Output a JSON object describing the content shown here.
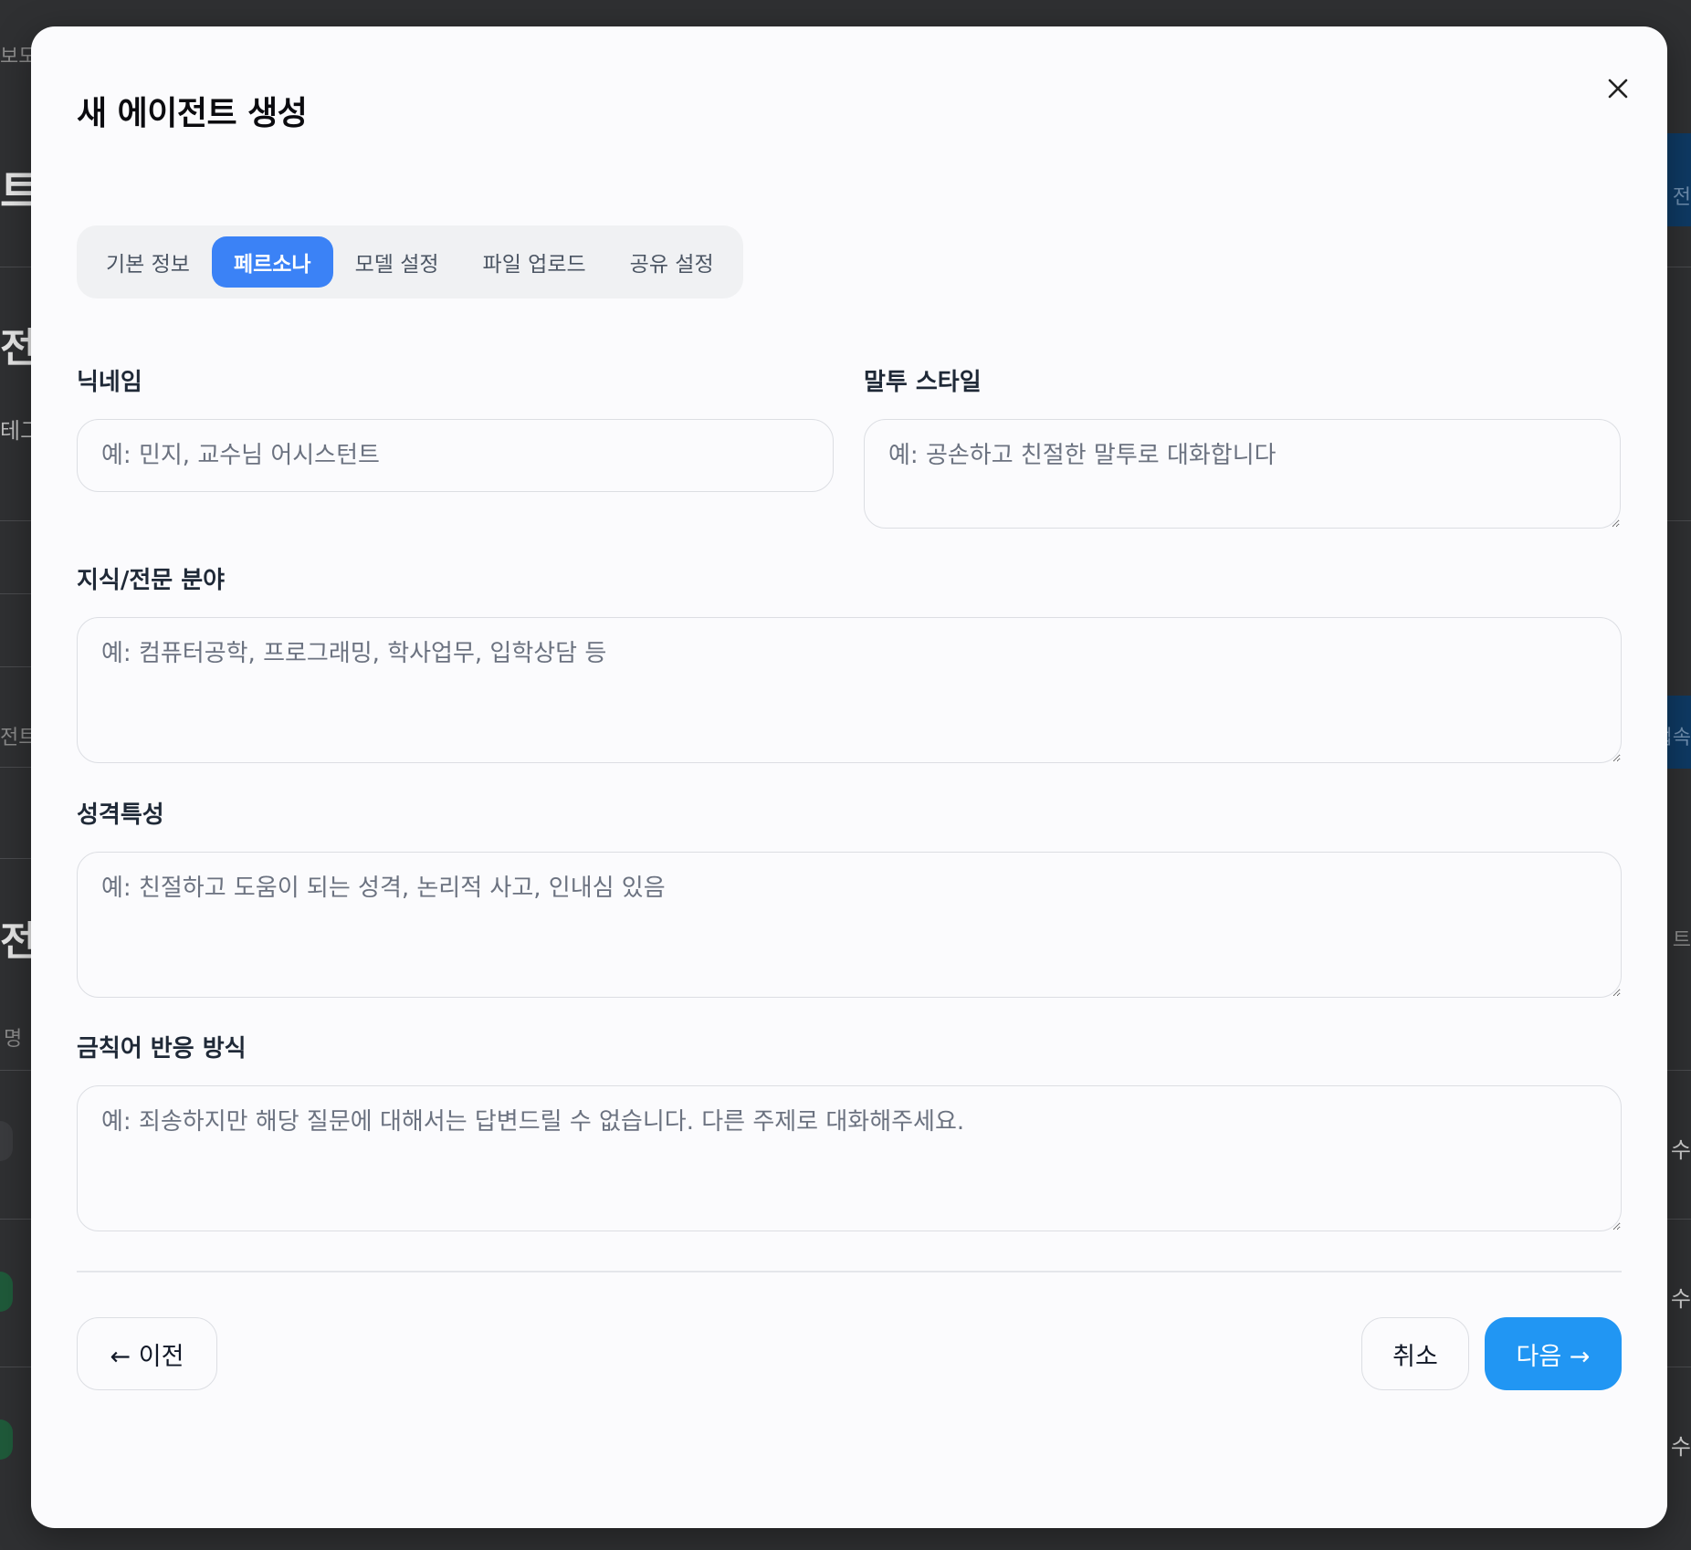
{
  "background": {
    "fragments": [
      "보모",
      "트",
      "전",
      "테그",
      "전트",
      "전",
      "명",
      "전",
      "접속",
      "트",
      "수",
      "수",
      "수"
    ]
  },
  "modal": {
    "title": "새 에이전트 생성",
    "close_icon": "close-icon"
  },
  "tabs": [
    {
      "label": "기본 정보",
      "active": false
    },
    {
      "label": "페르소나",
      "active": true
    },
    {
      "label": "모델 설정",
      "active": false
    },
    {
      "label": "파일 업로드",
      "active": false
    },
    {
      "label": "공유 설정",
      "active": false
    }
  ],
  "form": {
    "nickname": {
      "label": "닉네임",
      "value": "",
      "placeholder": "예: 민지, 교수님 어시스턴트"
    },
    "tone": {
      "label": "말투 스타일",
      "value": "",
      "placeholder": "예: 공손하고 친절한 말투로 대화합니다"
    },
    "expertise": {
      "label": "지식/전문 분야",
      "value": "",
      "placeholder": "예: 컴퓨터공학, 프로그래밍, 학사업무, 입학상담 등"
    },
    "personality": {
      "label": "성격특성",
      "value": "",
      "placeholder": "예: 친절하고 도움이 되는 성격, 논리적 사고, 인내심 있음"
    },
    "forbidden": {
      "label": "금칙어 반응 방식",
      "value": "",
      "placeholder": "예: 죄송하지만 해당 질문에 대해서는 답변드릴 수 없습니다. 다른 주제로 대화해주세요."
    }
  },
  "footer": {
    "prev_label": "← 이전",
    "cancel_label": "취소",
    "next_label": "다음 →"
  },
  "colors": {
    "accent": "#3b82f6",
    "primary_button": "#2196f3",
    "overlay": "#2f3032"
  }
}
